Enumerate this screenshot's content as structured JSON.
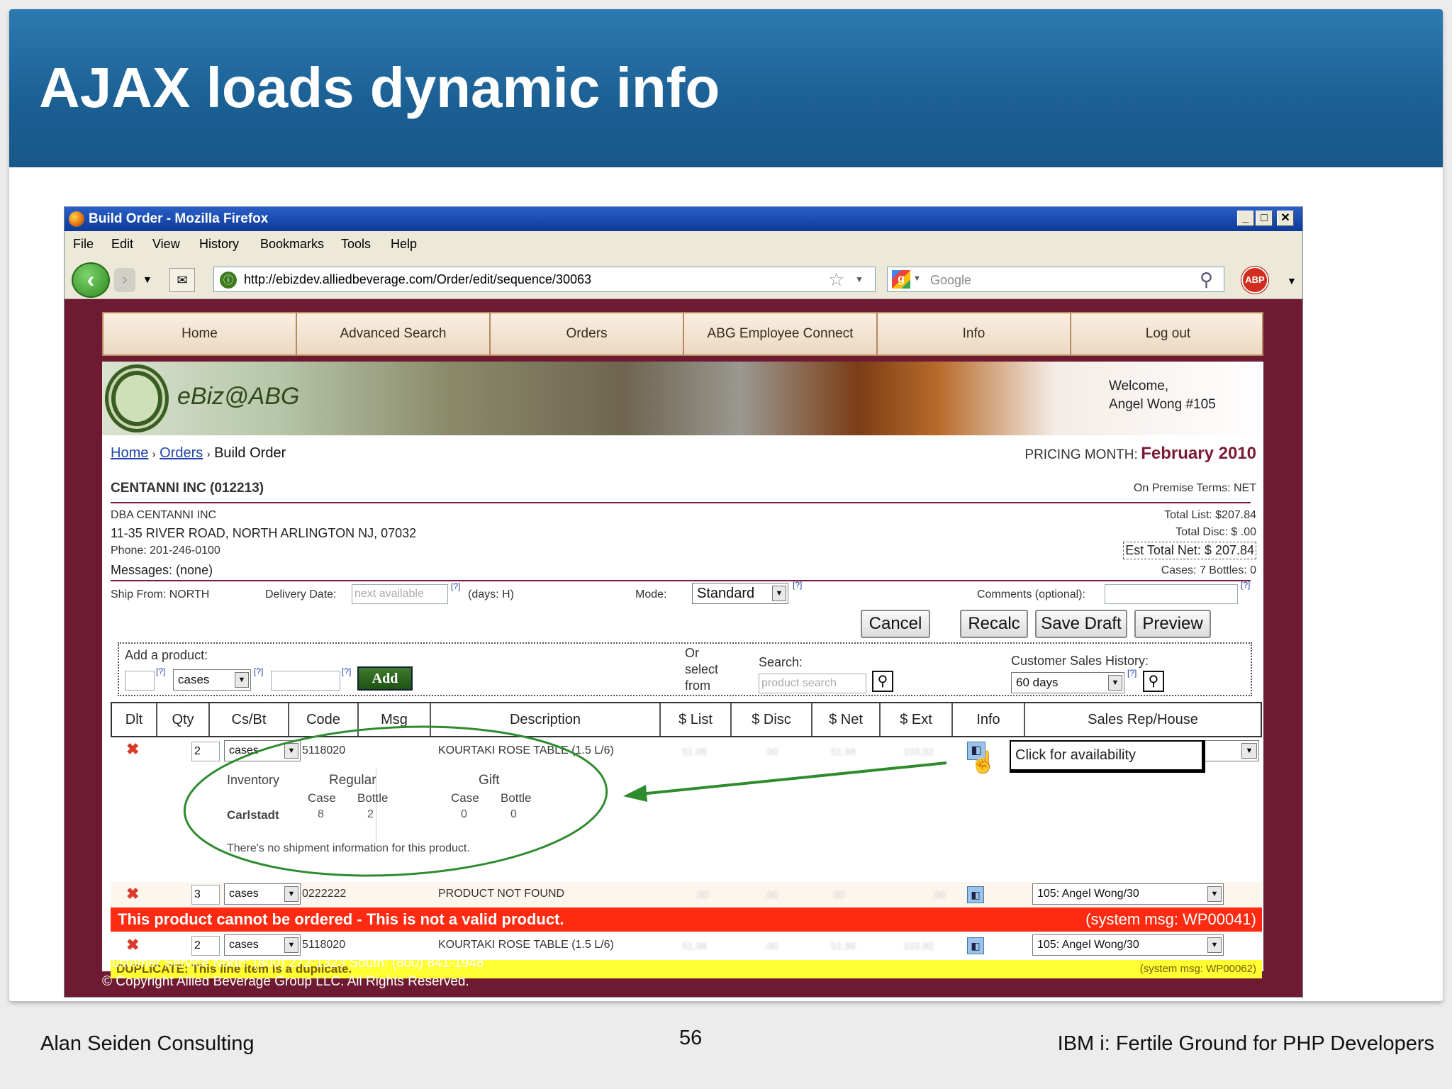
{
  "slide": {
    "title": "AJAX loads dynamic info",
    "footer_left": "Alan Seiden Consulting",
    "page_number": "56",
    "footer_right": "IBM i: Fertile Ground for PHP Developers"
  },
  "browser": {
    "title": "Build Order - Mozilla Firefox",
    "menu": [
      "File",
      "Edit",
      "View",
      "History",
      "Bookmarks",
      "Tools",
      "Help"
    ],
    "url": "http://ebizdev.alliedbeverage.com/Order/edit/sequence/30063",
    "search_placeholder": "Google",
    "abp_label": "ABP"
  },
  "nav": [
    "Home",
    "Advanced Search",
    "Orders",
    "ABG Employee Connect",
    "Info",
    "Log out"
  ],
  "banner": {
    "logo_text": "eBiz@ABG",
    "welcome_line1": "Welcome,",
    "welcome_line2": "Angel Wong #105"
  },
  "breadcrumb": {
    "home": "Home",
    "orders": "Orders",
    "current": "Build Order",
    "sep": "›"
  },
  "pricing": {
    "label": "PRICING MONTH:",
    "value": "February 2010"
  },
  "customer": {
    "name": "CENTANNI INC (012213)",
    "dba": "DBA CENTANNI INC",
    "address": "11-35 RIVER ROAD, NORTH ARLINGTON NJ, 07032",
    "phone": "Phone: 201-246-0100",
    "messages": "Messages: (none)",
    "terms": "On Premise  Terms: NET"
  },
  "totals": {
    "list": "Total List: $207.84",
    "disc": "Total Disc: $ .00",
    "net": "Est Total Net: $ 207.84",
    "cases": "Cases: 7  Bottles: 0"
  },
  "order_opts": {
    "ship_from": "Ship From: NORTH",
    "delivery_label": "Delivery Date:",
    "delivery_placeholder": "next available",
    "help": "[?]",
    "days": "(days: H)",
    "mode_label": "Mode:",
    "mode_value": "Standard",
    "comments_label": "Comments (optional):"
  },
  "buttons": {
    "cancel": "Cancel",
    "recalc": "Recalc",
    "save_draft": "Save Draft",
    "preview": "Preview",
    "add": "Add"
  },
  "add_product": {
    "label": "Add a product:",
    "unit": "cases",
    "or_select": [
      "Or",
      "select",
      "from"
    ],
    "search_label": "Search:",
    "search_placeholder": "product search",
    "history_label": "Customer Sales History:",
    "history_value": "60 days"
  },
  "table": {
    "headers": [
      "Dlt",
      "Qty",
      "Cs/Bt",
      "Code",
      "Msg",
      "Description",
      "$ List",
      "$ Disc",
      "$ Net",
      "$ Ext",
      "Info",
      "Sales Rep/House"
    ],
    "rows": [
      {
        "qty": "2",
        "unit": "cases",
        "code": "5118020",
        "desc": "KOURTAKI ROSE TABLE (1.5 L/6)",
        "rep": ""
      },
      {
        "qty": "3",
        "unit": "cases",
        "code": "0222222",
        "desc": "PRODUCT NOT FOUND",
        "rep": "105: Angel Wong/30"
      },
      {
        "qty": "2",
        "unit": "cases",
        "code": "5118020",
        "desc": "KOURTAKI ROSE TABLE (1.5 L/6)",
        "rep": "105: Angel Wong/30"
      }
    ],
    "tooltip": "Click for availability"
  },
  "inventory": {
    "label": "Inventory",
    "regular": "Regular",
    "gift": "Gift",
    "case": "Case",
    "bottle": "Bottle",
    "location": "Carlstadt",
    "regular_case": "8",
    "regular_bottle": "2",
    "gift_case": "0",
    "gift_bottle": "0",
    "note": "There's no shipment information for this product."
  },
  "messages": {
    "error": "This product cannot be ordered - This is not a valid product.",
    "error_code": "(system msg: WP00041)",
    "duplicate": "DUPLICATE: This line item is a duplicate.",
    "duplicate_code": "(system msg: WP00062)"
  },
  "page_footer": {
    "service": "Customer Service North: (800) 272-1323  South: (800) 841-1948",
    "copyright": "© Copyright Allied Beverage Group LLC. All Rights Reserved."
  },
  "colors": {
    "slide_band": "#1b5f93",
    "page_bg": "#6f1a33",
    "error_bg": "#ff2a12",
    "dup_bg": "#ffff33",
    "annot": "#2e8b2e"
  }
}
